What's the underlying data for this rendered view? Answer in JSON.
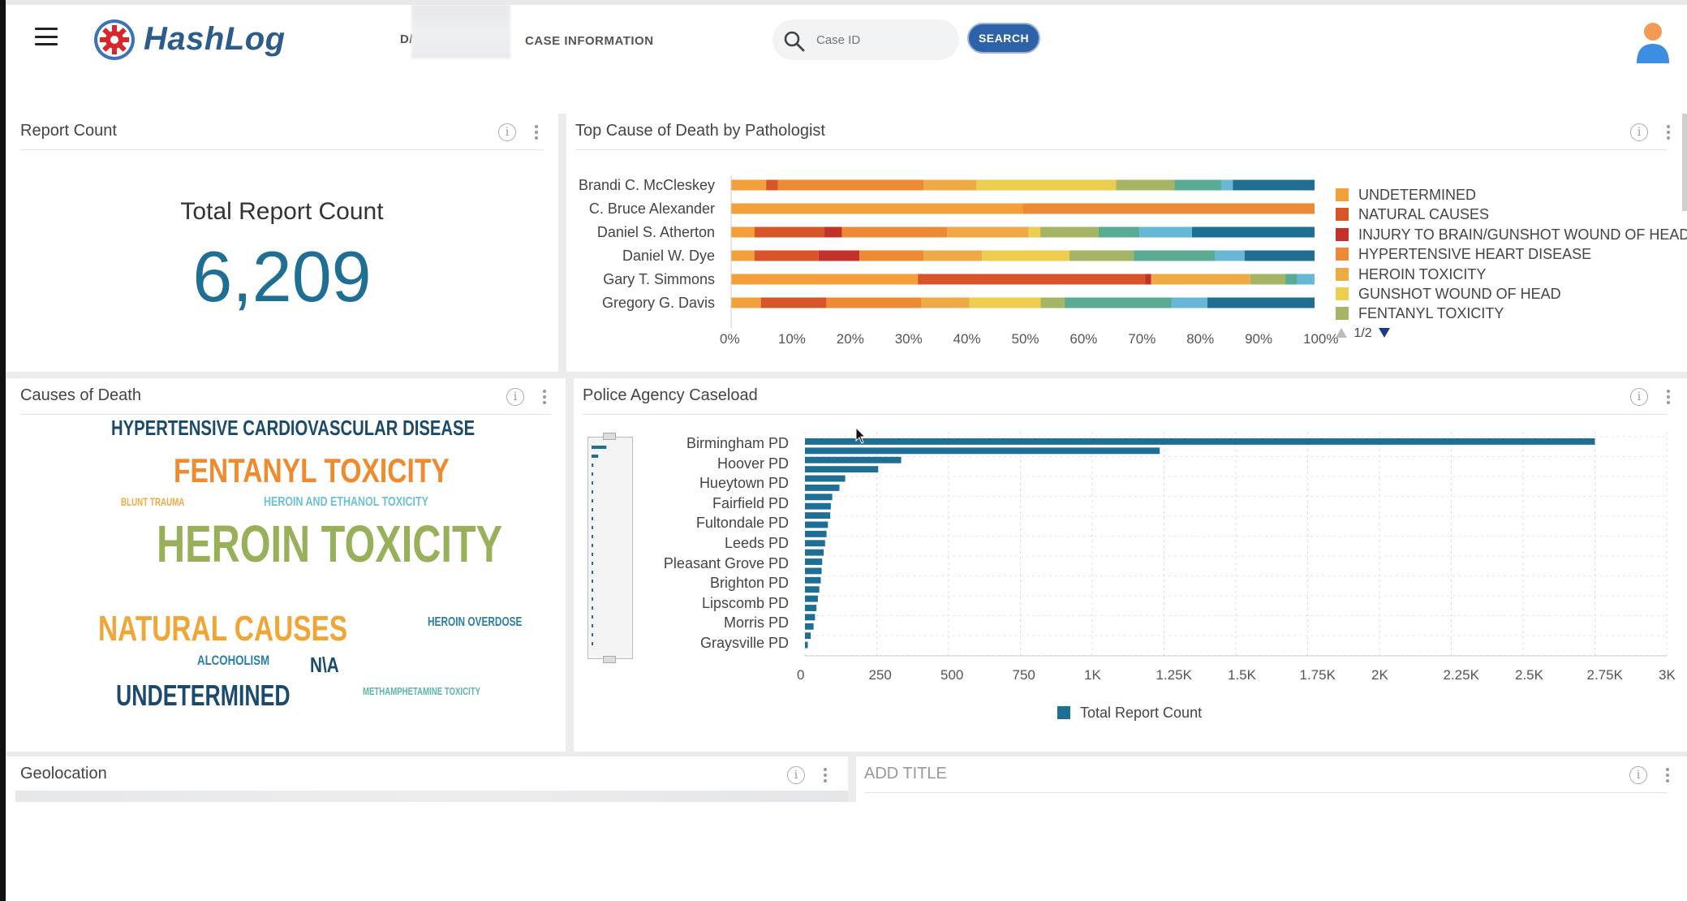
{
  "app": {
    "logo_text": "HashLog",
    "nav_dashboard_partial": "D/",
    "nav_case_information": "CASE INFORMATION",
    "search_placeholder": "Case ID",
    "search_button": "SEARCH",
    "icons": {
      "menu": "hamburger-menu-icon",
      "search": "search-icon",
      "avatar": "user-avatar-icon",
      "info": "info-icon",
      "more": "kebab-menu-icon"
    }
  },
  "colors": {
    "brand": "#2c5d8a",
    "button": "#2e62a8",
    "bar_series": "#1f6e94"
  },
  "report_count": {
    "title": "Report Count",
    "label": "Total Report Count",
    "value": "6,209"
  },
  "cause_by_pathologist": {
    "title": "Top Cause of Death by Pathologist",
    "pager": "1/2",
    "legend": [
      {
        "name": "UNDETERMINED",
        "color": "#f4a03a"
      },
      {
        "name": "NATURAL CAUSES",
        "color": "#d8552a"
      },
      {
        "name": "INJURY TO BRAIN/GUNSHOT WOUND OF HEAD",
        "color": "#c2312a"
      },
      {
        "name": "HYPERTENSIVE HEART DISEASE",
        "color": "#ee8a33"
      },
      {
        "name": "HEROIN TOXICITY",
        "color": "#f0aa45"
      },
      {
        "name": "GUNSHOT WOUND OF HEAD",
        "color": "#eccd4e"
      },
      {
        "name": "FENTANYL TOXICITY",
        "color": "#a6b565"
      }
    ]
  },
  "causes_of_death": {
    "title": "Causes of Death",
    "words": [
      {
        "text": "HYPERTENSIVE CARDIOVASCULAR DISEASE",
        "color": "#1a4a6e"
      },
      {
        "text": "FENTANYL TOXICITY",
        "color": "#f08a2c"
      },
      {
        "text": "BLUNT TRAUMA",
        "color": "#f0aa45"
      },
      {
        "text": "HEROIN AND ETHANOL TOXICITY",
        "color": "#6cc0d8"
      },
      {
        "text": "HEROIN TOXICITY",
        "color": "#98b05a"
      },
      {
        "text": "NATURAL CAUSES",
        "color": "#f0a535"
      },
      {
        "text": "HEROIN OVERDOSE",
        "color": "#2a7fa8"
      },
      {
        "text": "ALCOHOLISM",
        "color": "#2a7fa8"
      },
      {
        "text": "N\\A",
        "color": "#1a4a6e"
      },
      {
        "text": "METHAMPHETAMINE TOXICITY",
        "color": "#5ab6a6"
      },
      {
        "text": "UNDETERMINED",
        "color": "#1a4a6e"
      }
    ]
  },
  "police_caseload": {
    "title": "Police Agency Caseload"
  },
  "geolocation": {
    "title": "Geolocation"
  },
  "add_title": {
    "title": "ADD TITLE"
  },
  "chart_data": [
    {
      "type": "bar",
      "title": "Top Cause of Death by Pathologist",
      "orientation": "horizontal",
      "stacked": "percent",
      "categories": [
        "Brandi C. McCleskey",
        "C. Bruce Alexander",
        "Daniel S. Atherton",
        "Daniel W. Dye",
        "Gary T. Simmons",
        "Gregory G. Davis"
      ],
      "x_ticks": [
        "0%",
        "10%",
        "20%",
        "30%",
        "40%",
        "50%",
        "60%",
        "70%",
        "80%",
        "90%",
        "100%"
      ],
      "segment_colors": [
        "#f4a03a",
        "#d8552a",
        "#c2312a",
        "#ee8a33",
        "#f0aa45",
        "#eccd4e",
        "#a6b565",
        "#5aab94",
        "#66b8d6",
        "#1f6e94"
      ],
      "segments": [
        [
          6,
          2,
          0,
          25,
          9,
          24,
          10,
          8,
          2,
          14
        ],
        [
          50,
          0,
          0,
          50,
          0,
          0,
          0,
          0,
          0,
          0
        ],
        [
          4,
          12,
          3,
          18,
          14,
          2,
          10,
          7,
          9,
          21
        ],
        [
          4,
          11,
          7,
          11,
          10,
          15,
          11,
          14,
          5,
          12
        ],
        [
          32,
          39,
          1,
          0,
          17,
          0,
          6,
          2,
          3,
          0
        ],
        [
          5,
          11,
          0,
          16,
          8,
          12,
          4,
          18,
          6,
          18
        ]
      ],
      "legend": [
        "UNDETERMINED",
        "NATURAL CAUSES",
        "INJURY TO BRAIN/GUNSHOT WOUND OF HEAD",
        "HYPERTENSIVE HEART DISEASE",
        "HEROIN TOXICITY",
        "GUNSHOT WOUND OF HEAD",
        "FENTANYL TOXICITY"
      ]
    },
    {
      "type": "bar",
      "title": "Police Agency Caseload",
      "orientation": "horizontal",
      "xlim": [
        0,
        3000
      ],
      "x_ticks": [
        "0",
        "250",
        "500",
        "750",
        "1K",
        "1.25K",
        "1.5K",
        "1.75K",
        "2K",
        "2.25K",
        "2.5K",
        "2.75K",
        "3K"
      ],
      "categories": [
        "Birmingham PD",
        "Hoover PD",
        "Hueytown PD",
        "Fairfield PD",
        "Fultondale PD",
        "Leeds PD",
        "Pleasant Grove PD",
        "Brighton PD",
        "Lipscomb PD",
        "Morris PD",
        "Graysville PD"
      ],
      "series": [
        {
          "name": "Total Report Count",
          "values": [
            2750,
            1235,
            335,
            255,
            140,
            120,
            95,
            90,
            88,
            80,
            75,
            70,
            65,
            60,
            58,
            55,
            50,
            45,
            40,
            35,
            30,
            20,
            10
          ]
        }
      ],
      "grid": true,
      "legend_position": "bottom"
    }
  ]
}
